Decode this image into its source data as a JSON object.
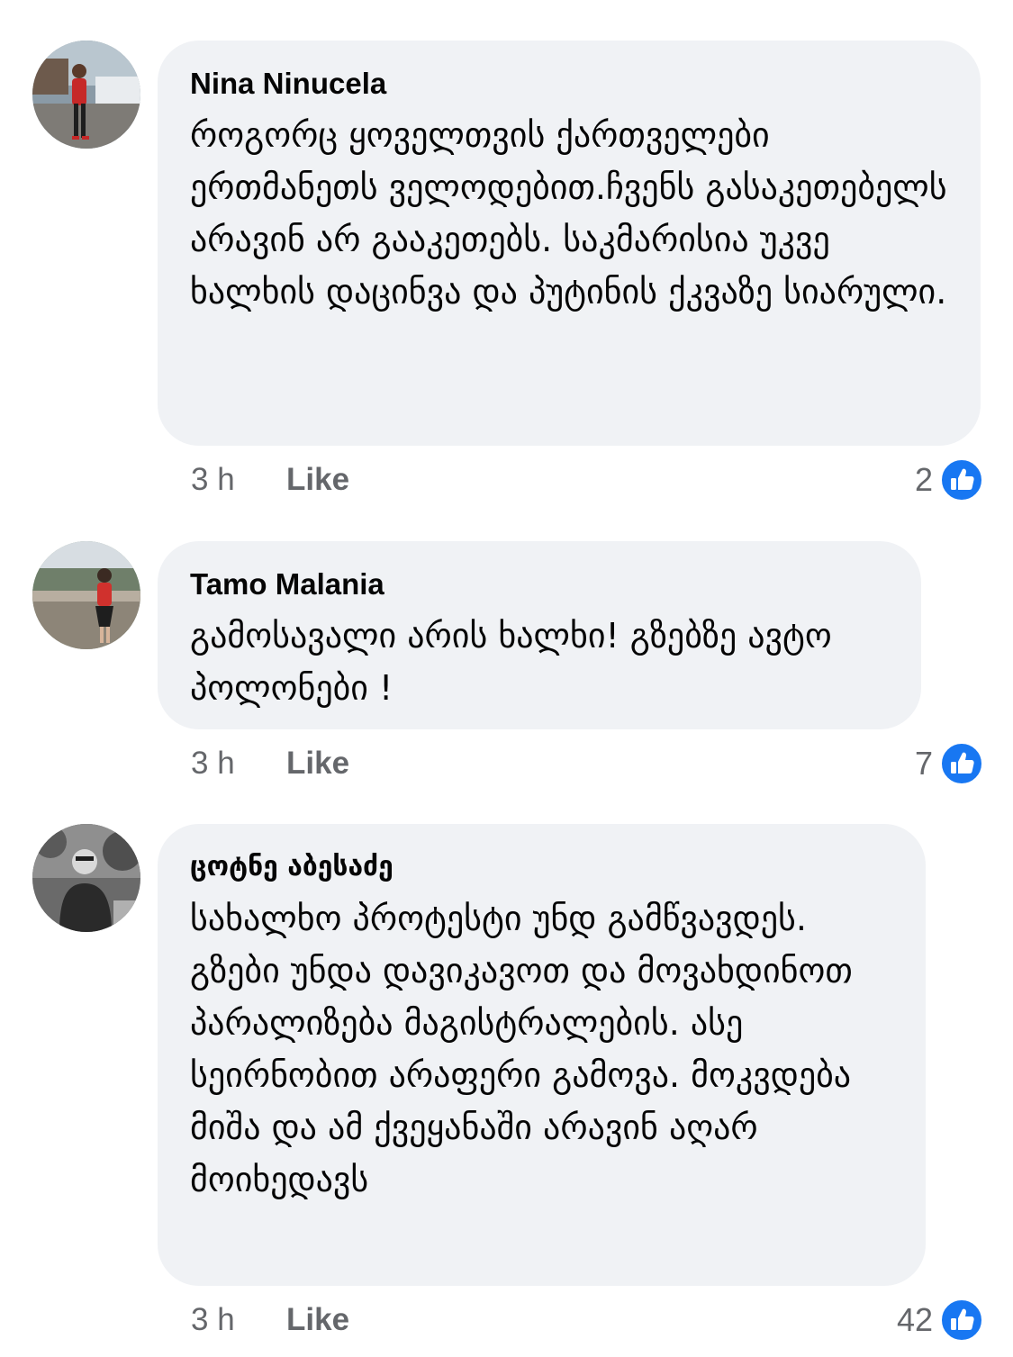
{
  "comments": [
    {
      "author": "Nina Ninucela",
      "text": "როგორც ყოველთვის ქართველები ერთმანეთს ველოდებით.ჩვენს გასაკეთებელს არავინ არ გააკეთებს. საკმარისია უკვე ხალხის დაცინვა და პუტინის ქკვაზე სიარული.",
      "time": "3 h",
      "like_label": "Like",
      "reaction_count": "2",
      "reaction_icon": "like-reaction-icon"
    },
    {
      "author": "Tamo Malania",
      "text": "გამოსავალი არის ხალხი! გზებზე ავტო პოლონები !",
      "time": "3 h",
      "like_label": "Like",
      "reaction_count": "7",
      "reaction_icon": "like-reaction-icon"
    },
    {
      "author": "ცოტნე აბესაძე",
      "text": "სახალხო პროტესტი უნდ გამწვავდეს. გზები უნდა დავიკავოთ და მოვახდინოთ პარალიზება მაგისტრალების. ასე სეირნობით არაფერი გამოვა. მოკვდება მიშა და ამ ქვეყანაში არავინ აღარ მოიხედავს",
      "time": "3 h",
      "like_label": "Like",
      "reaction_count": "42",
      "reaction_icon": "like-reaction-icon"
    }
  ],
  "colors": {
    "bubble_bg": "#f0f2f5",
    "meta_text": "#65676b",
    "like_blue": "#1877f2"
  }
}
